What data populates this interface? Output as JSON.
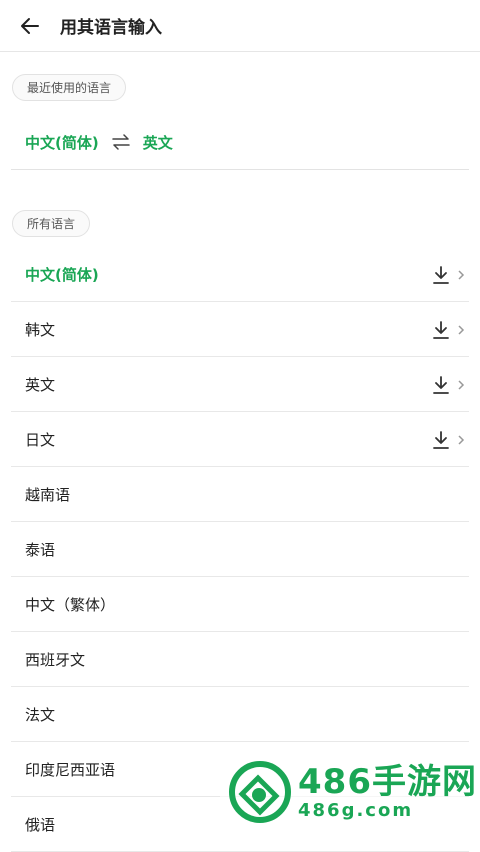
{
  "header": {
    "title": "用其语言输入"
  },
  "recent": {
    "chip": "最近使用的语言",
    "source": "中文(简体)",
    "target": "英文"
  },
  "all": {
    "chip": "所有语言",
    "items": [
      {
        "label": "中文(简体)",
        "active": true,
        "downloadable": true
      },
      {
        "label": "韩文",
        "active": false,
        "downloadable": true
      },
      {
        "label": "英文",
        "active": false,
        "downloadable": true
      },
      {
        "label": "日文",
        "active": false,
        "downloadable": true
      },
      {
        "label": "越南语",
        "active": false,
        "downloadable": false
      },
      {
        "label": "泰语",
        "active": false,
        "downloadable": false
      },
      {
        "label": "中文（繁体）",
        "active": false,
        "downloadable": false
      },
      {
        "label": "西班牙文",
        "active": false,
        "downloadable": false
      },
      {
        "label": "法文",
        "active": false,
        "downloadable": false
      },
      {
        "label": "印度尼西亚语",
        "active": false,
        "downloadable": false
      },
      {
        "label": "俄语",
        "active": false,
        "downloadable": false
      }
    ]
  },
  "watermark": {
    "brand": "486手游网",
    "domain": "486g.com"
  },
  "colors": {
    "accent": "#1aa655",
    "text": "#222222",
    "divider": "#e8e8e8"
  },
  "icons": {
    "back": "arrow-left-icon",
    "swap": "swap-arrows-icon",
    "download": "download-icon",
    "chevron": "chevron-right-icon"
  }
}
